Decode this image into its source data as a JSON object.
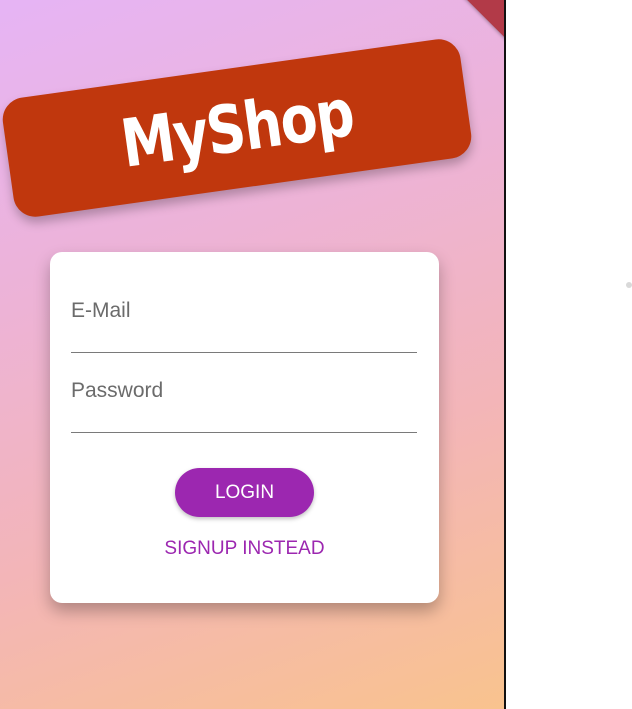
{
  "brand": {
    "title": "MyShop",
    "banner_color": "#c0370d"
  },
  "auth_form": {
    "email": {
      "label": "E-Mail",
      "value": ""
    },
    "password": {
      "label": "Password",
      "value": ""
    },
    "login_label": "LOGIN",
    "switch_mode_label": "SIGNUP INSTEAD"
  },
  "colors": {
    "accent": "#9c27b0",
    "gradient_start": "#e6b4f5",
    "gradient_end": "#f9c38e"
  }
}
